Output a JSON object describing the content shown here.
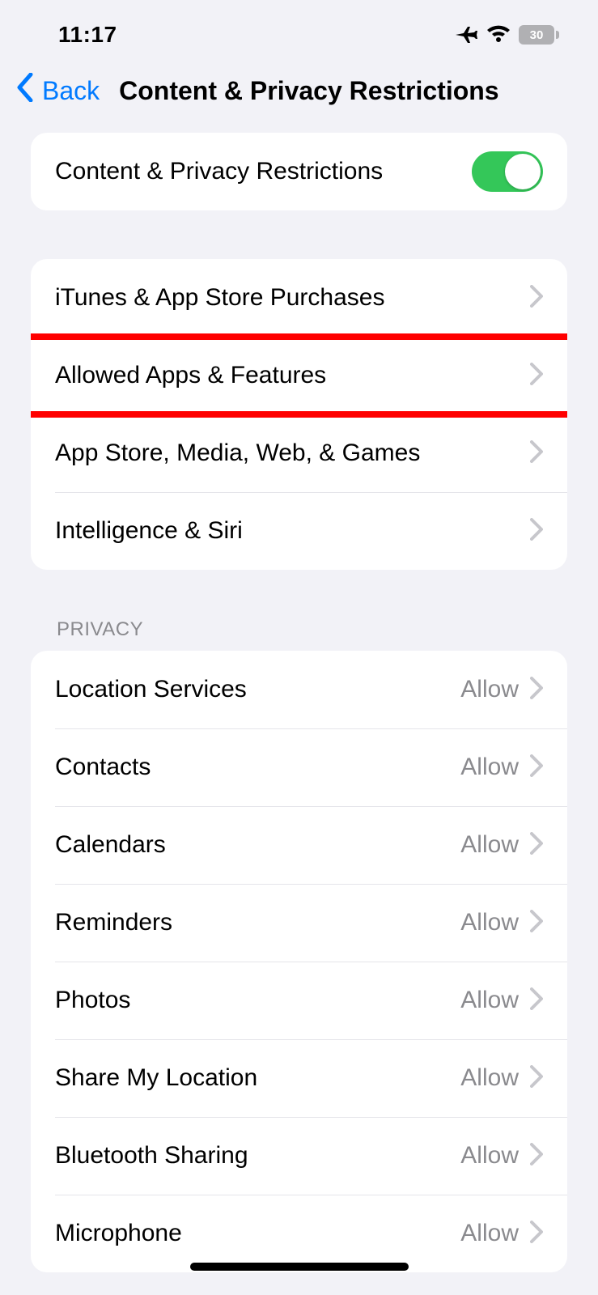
{
  "status": {
    "time": "11:17",
    "battery_pct": "30"
  },
  "nav": {
    "back_label": "Back",
    "title": "Content & Privacy Restrictions"
  },
  "toggle_row": {
    "label": "Content & Privacy Restrictions",
    "on": true
  },
  "group1": {
    "items": [
      {
        "label": "iTunes & App Store Purchases"
      },
      {
        "label": "Allowed Apps & Features"
      },
      {
        "label": "App Store, Media, Web, & Games"
      },
      {
        "label": "Intelligence & Siri"
      }
    ],
    "highlighted_index": 1
  },
  "privacy": {
    "header": "PRIVACY",
    "items": [
      {
        "label": "Location Services",
        "value": "Allow"
      },
      {
        "label": "Contacts",
        "value": "Allow"
      },
      {
        "label": "Calendars",
        "value": "Allow"
      },
      {
        "label": "Reminders",
        "value": "Allow"
      },
      {
        "label": "Photos",
        "value": "Allow"
      },
      {
        "label": "Share My Location",
        "value": "Allow"
      },
      {
        "label": "Bluetooth Sharing",
        "value": "Allow"
      },
      {
        "label": "Microphone",
        "value": "Allow"
      }
    ]
  }
}
